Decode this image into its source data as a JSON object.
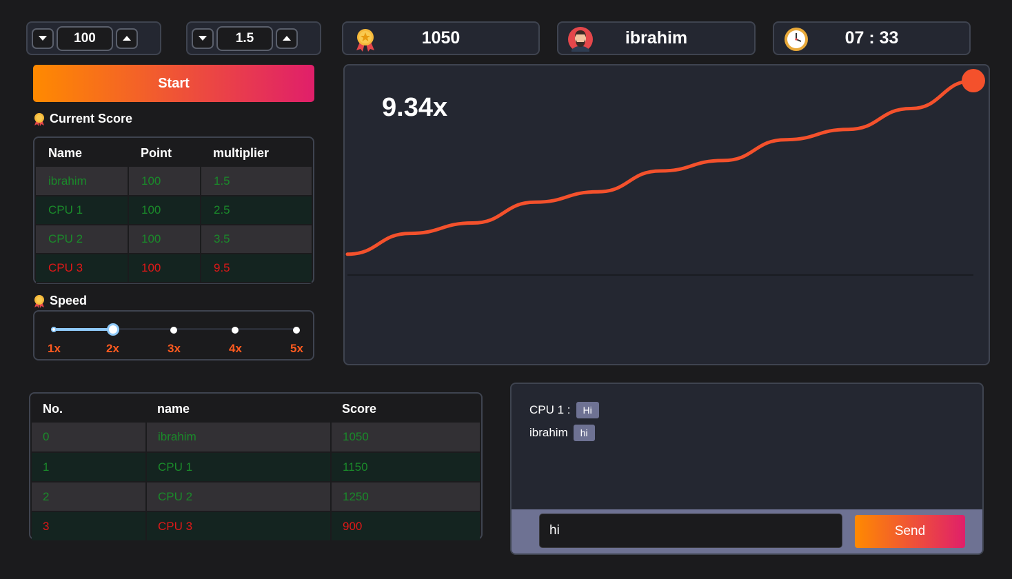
{
  "bet": {
    "value": "100"
  },
  "auto_cashout": {
    "value": "1.5"
  },
  "points": {
    "value": "1050"
  },
  "user": {
    "name": "ibrahim"
  },
  "timer": {
    "value": "07 : 33"
  },
  "start_label": "Start",
  "current_score": {
    "title": "Current Score",
    "headers": [
      "Name",
      "Point",
      "multiplier"
    ],
    "rows": [
      {
        "name": "ibrahim",
        "point": "100",
        "multiplier": "1.5",
        "status": "green"
      },
      {
        "name": "CPU 1",
        "point": "100",
        "multiplier": "2.5",
        "status": "green"
      },
      {
        "name": "CPU 2",
        "point": "100",
        "multiplier": "3.5",
        "status": "green"
      },
      {
        "name": "CPU 3",
        "point": "100",
        "multiplier": "9.5",
        "status": "red"
      }
    ]
  },
  "speed": {
    "title": "Speed",
    "options": [
      "1x",
      "2x",
      "3x",
      "4x",
      "5x"
    ],
    "selected": "2x"
  },
  "graph": {
    "multiplier": "9.34x"
  },
  "chart_data": {
    "type": "line",
    "title": "",
    "x": [
      0,
      1,
      2,
      3,
      4,
      5,
      6,
      7,
      8,
      9,
      10
    ],
    "series": [
      {
        "values": [
          1.0,
          2.0,
          2.5,
          3.5,
          4.0,
          5.0,
          5.5,
          6.5,
          7.0,
          8.0,
          9.34
        ]
      }
    ],
    "ylim": [
      0,
      9.34
    ],
    "grid": false,
    "line_color": "#f4512c"
  },
  "leaderboard": {
    "headers": [
      "No.",
      "name",
      "Score"
    ],
    "rows": [
      {
        "no": "0",
        "name": "ibrahim",
        "score": "1050",
        "status": "green"
      },
      {
        "no": "1",
        "name": "CPU 1",
        "score": "1150",
        "status": "green"
      },
      {
        "no": "2",
        "name": "CPU 2",
        "score": "1250",
        "status": "green"
      },
      {
        "no": "3",
        "name": "CPU 3",
        "score": "900",
        "status": "red"
      }
    ]
  },
  "chat": {
    "messages": [
      {
        "sender": "CPU 1 :",
        "text": "Hi"
      },
      {
        "sender": "ibrahim",
        "text": "hi"
      }
    ],
    "input_value": "hi",
    "send_label": "Send"
  },
  "colors": {
    "accent_start": "#ff8a00",
    "accent_end": "#e01f6a",
    "curve": "#f4512c",
    "win": "#1a8a2a",
    "loss": "#e01818"
  },
  "icons": [
    "chevron-down-icon",
    "chevron-up-icon",
    "medal-icon",
    "user-avatar-icon",
    "clock-icon"
  ]
}
